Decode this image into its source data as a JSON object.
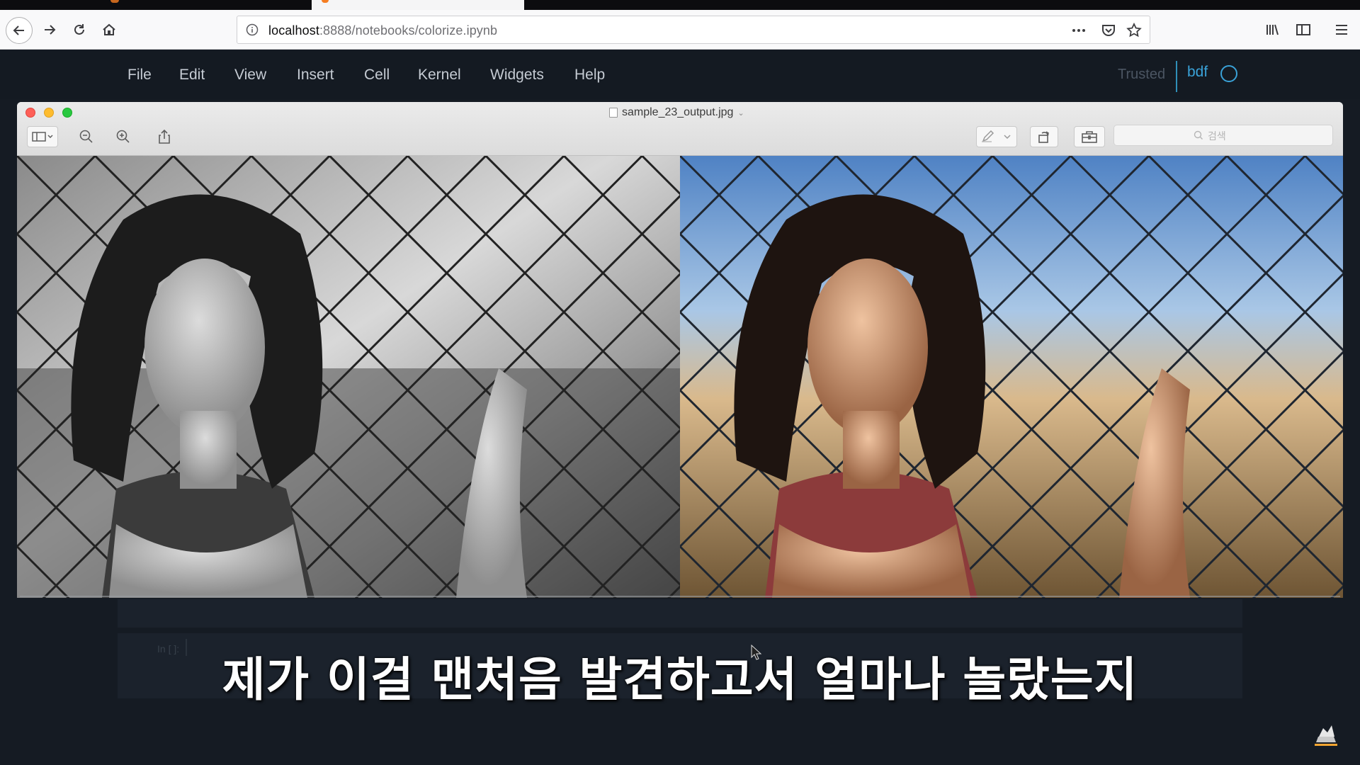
{
  "browser": {
    "url_host": "localhost",
    "url_path": ":8888/notebooks/colorize.ipynb",
    "url_icons": [
      "info-icon",
      "more-icon",
      "pocket-icon",
      "star-icon"
    ],
    "toolbar_icons": [
      "back-arrow-icon",
      "forward-arrow-icon",
      "reload-icon",
      "home-icon",
      "library-icon",
      "sidebar-icon",
      "hamburger-menu-icon"
    ]
  },
  "jupyter": {
    "menu": [
      "File",
      "Edit",
      "View",
      "Insert",
      "Cell",
      "Kernel",
      "Widgets",
      "Help"
    ],
    "trusted": "Trusted",
    "kernel_name": "bdf",
    "cell_prompt": "In [ ]:"
  },
  "preview": {
    "filename": "sample_23_output.jpg",
    "search_placeholder": "검색",
    "tool_icons": [
      "sidebar-icon",
      "zoom-out-icon",
      "zoom-in-icon",
      "share-icon",
      "markup-pen-icon",
      "rotate-icon",
      "toolbox-icon"
    ]
  },
  "subtitle": "제가 이걸 맨처음 발견하고서 얼마나 놀랐는지",
  "colors": {
    "accent": "#3aa2d8",
    "traffic_close": "#fd5f57",
    "traffic_minimize": "#febc2e",
    "traffic_zoom": "#28c840"
  }
}
